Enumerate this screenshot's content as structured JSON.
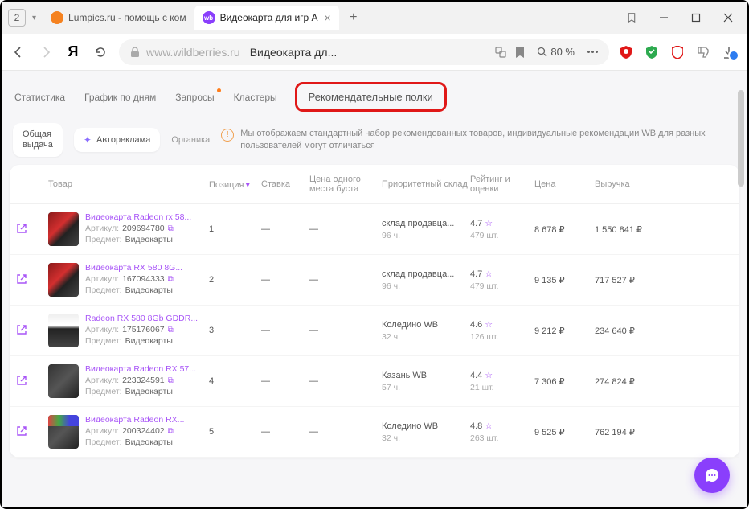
{
  "browser": {
    "tab_count": "2",
    "tabs": [
      {
        "favicon": "#f58220",
        "title": "Lumpics.ru - помощь с ком"
      },
      {
        "favicon": "#8a3ffc",
        "title": "Видеокарта для игр А"
      }
    ],
    "url_host": "www.wildberries.ru",
    "url_title": "Видеокарта дл...",
    "zoom": "80 %"
  },
  "subtabs": {
    "stats": "Статистика",
    "daily": "График по дням",
    "queries": "Запросы",
    "clusters": "Кластеры",
    "recs": "Рекомендательные полки"
  },
  "filters": {
    "all": "Общая\nвыдача",
    "auto": "Автореклама",
    "organic": "Органика",
    "banner": "Мы отображаем стандартный набор рекомендованных товаров, индивидуальные рекомендации WB для разных пользователей могут отличаться"
  },
  "table": {
    "headers": {
      "product": "Товар",
      "position": "Позиция",
      "rate": "Ставка",
      "boost_price": "Цена одного места буста",
      "priority": "Приоритетный склад",
      "rating": "Рейтинг и оценки",
      "price": "Цена",
      "revenue": "Выручка"
    },
    "labels": {
      "sku": "Артикул:",
      "subject": "Предмет:",
      "subject_val": "Видеокарты"
    },
    "rows": [
      {
        "thumb": "red",
        "name": "Видеокарта Radeon rx 58...",
        "sku": "209694780",
        "pos": "1",
        "rate": "—",
        "boost": "—",
        "wh": "склад продавца...",
        "wh2": "96 ч.",
        "rating": "4.7",
        "reviews": "479 шт.",
        "price": "8 678 ₽",
        "revenue": "1 550 841 ₽"
      },
      {
        "thumb": "red",
        "name": "Видеокарта RX 580 8G...",
        "sku": "167094333",
        "pos": "2",
        "rate": "—",
        "boost": "—",
        "wh": "склад продавца...",
        "wh2": "96 ч.",
        "rating": "4.7",
        "reviews": "479 шт.",
        "price": "9 135 ₽",
        "revenue": "717 527 ₽"
      },
      {
        "thumb": "white",
        "name": "Radeon RX 580 8Gb GDDR...",
        "sku": "175176067",
        "pos": "3",
        "rate": "—",
        "boost": "—",
        "wh": "Коледино WB",
        "wh2": "32 ч.",
        "rating": "4.6",
        "reviews": "126 шт.",
        "price": "9 212 ₽",
        "revenue": "234 640 ₽"
      },
      {
        "thumb": "",
        "name": "Видеокарта Radeon RX 57...",
        "sku": "223324591",
        "pos": "4",
        "rate": "—",
        "boost": "—",
        "wh": "Казань WB",
        "wh2": "57 ч.",
        "rating": "4.4",
        "reviews": "21 шт.",
        "price": "7 306 ₽",
        "revenue": "274 824 ₽"
      },
      {
        "thumb": "colorful",
        "name": "Видеокарта Radeon RX...",
        "sku": "200324402",
        "pos": "5",
        "rate": "—",
        "boost": "—",
        "wh": "Коледино WB",
        "wh2": "32 ч.",
        "rating": "4.8",
        "reviews": "263 шт.",
        "price": "9 525 ₽",
        "revenue": "762 194 ₽"
      }
    ]
  }
}
